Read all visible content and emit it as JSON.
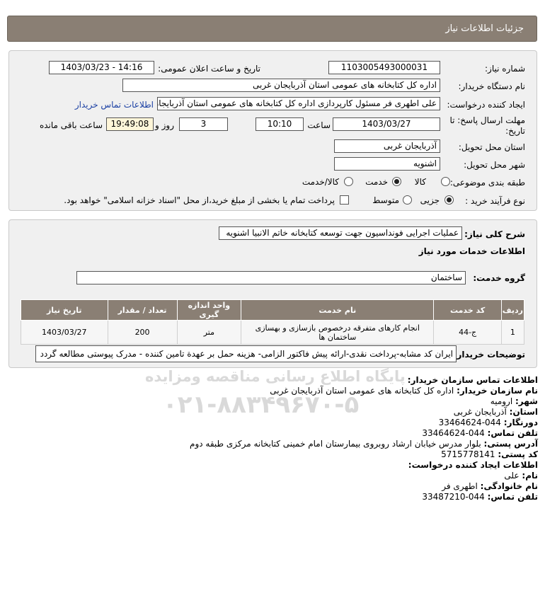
{
  "header": {
    "title": "جزئیات اطلاعات نیاز"
  },
  "form": {
    "need_number_label": "شماره نیاز:",
    "need_number": "1103005493000031",
    "announce_label": "تاریخ و ساعت اعلان عمومی:",
    "announce_value": "1403/03/23 - 14:16",
    "buyer_org_label": "نام دستگاه خریدار:",
    "buyer_org": "اداره کل کتابخانه های عمومی استان آذربایجان غربی",
    "creator_label": "ایجاد کننده درخواست:",
    "creator": "علی اطهری فر مسئول کارپردازی اداره کل کتابخانه های عمومی استان آذربایجان غربی",
    "contact_link": "اطلاعات تماس خریدار",
    "deadline_label": "مهلت ارسال پاسخ: تا تاریخ:",
    "deadline_date": "1403/03/27",
    "time_label": "ساعت",
    "deadline_time": "10:10",
    "days": "3",
    "days_label": "روز و",
    "remaining_time": "19:49:08",
    "remaining_label": "ساعت باقی مانده",
    "province_label": "استان محل تحویل:",
    "province": "آذربایجان غربی",
    "city_label": "شهر محل تحویل:",
    "city": "اشنویه",
    "category_label": "طبقه بندی موضوعی:",
    "category_options": [
      "کالا",
      "خدمت",
      "کالا/خدمت"
    ],
    "category_selected": "خدمت",
    "process_label": "نوع فرآیند خرید :",
    "process_options": [
      "جزیی",
      "متوسط"
    ],
    "process_selected": "جزیی",
    "treasury_note": "پرداخت تمام یا بخشی از مبلغ خرید،از محل \"اسناد خزانه اسلامی\" خواهد بود."
  },
  "details": {
    "summary_label": "شرح کلی نیاز:",
    "summary": "عملیات اجرایی فونداسیون جهت توسعه کتابخانه خاتم الانبیا اشنویه",
    "services_heading": "اطلاعات خدمات مورد نیاز",
    "service_group_label": "گروه خدمت:",
    "service_group": "ساختمان",
    "table": {
      "headers": [
        "ردیف",
        "کد خدمت",
        "نام خدمت",
        "واحد اندازه گیری",
        "تعداد / مقدار",
        "تاریخ نیاز"
      ],
      "rows": [
        [
          "1",
          "ج-44",
          "انجام کارهای متفرقه درخصوص بازسازی و بهسازی ساختمان ها",
          "متر",
          "200",
          "1403/03/27"
        ]
      ]
    },
    "buyer_notes_label": "توضیحات خریدار:",
    "buyer_notes": "ایران کد مشابه-پرداخت نقدی-ارائه پیش فاکتور الزامی- هزینه حمل بر عهدة تامین کننده - مدرک پیوستی مطالعه گردد"
  },
  "contact": {
    "heading": "اطلاعات تماس سازمان خریدار:",
    "org_label": "نام سازمان خریدار:",
    "org": "اداره کل کتابخانه های عمومی استان آذربایجان غربی",
    "city_label": "شهر:",
    "city": "ارومیه",
    "province_label": "استان:",
    "province": "آذربایجان غربی",
    "fax_label": "دورنگار:",
    "fax": "044-33464624",
    "phone_label": "تلفن تماس:",
    "phone": "044-33464624",
    "address_label": "آدرس پستی:",
    "address": "بلوار مدرس خیابان ارشاد روبروی بیمارستان امام خمینی کتابخانه مرکزی طبقه دوم",
    "postal_label": "کد پستی:",
    "postal": "5715778141",
    "creator_heading": "اطلاعات ایجاد کننده درخواست:",
    "name_label": "نام:",
    "name": "علی",
    "family_label": "نام خانوادگی:",
    "family": "اطهری فر",
    "creator_phone_label": "تلفن تماس:",
    "creator_phone": "044-33487210"
  },
  "watermark": {
    "line1": "پایگاه اطلاع رسانی مناقصه ومزایده",
    "line2": "۰۲۱-۸۸۳۴۹۶۷۰-۵"
  }
}
